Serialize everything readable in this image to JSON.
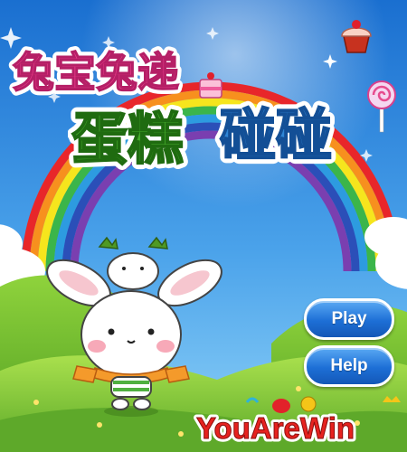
{
  "game": {
    "title_line1": "兔宝兔递",
    "title_line2_part1": "蛋糕",
    "title_line2_part2": "碰碰"
  },
  "menu": {
    "play_label": "Play",
    "help_label": "Help"
  },
  "brand": {
    "logo_text": "YouAreWin"
  },
  "colors": {
    "sky": "#1e7fd6",
    "button": "#1d6fd6",
    "grass": "#6dbb2e",
    "title_green": "#3c9e1f",
    "title_blue": "#2c7fd0"
  }
}
